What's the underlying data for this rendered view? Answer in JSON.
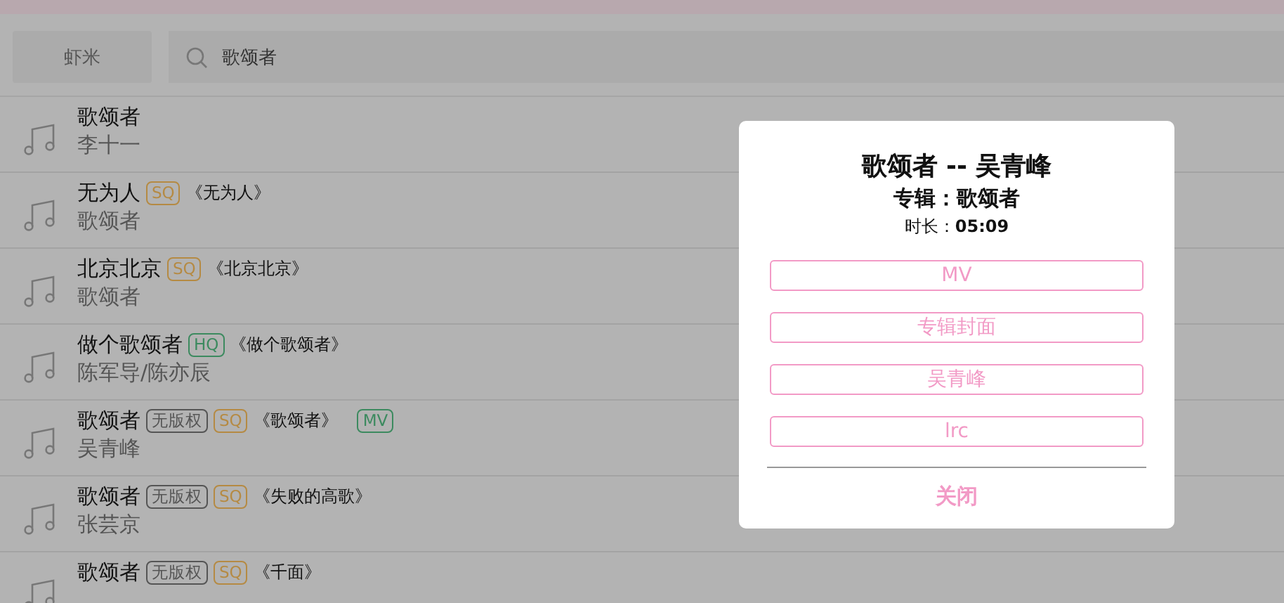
{
  "source_button": {
    "label": "虾米"
  },
  "search": {
    "value": "歌颂者"
  },
  "songs": [
    {
      "title": "歌颂者",
      "artist": "李十一"
    },
    {
      "title": "无为人",
      "tags": [
        {
          "kind": "sq",
          "label": "SQ"
        }
      ],
      "album": "《无为人》",
      "artist": "歌颂者"
    },
    {
      "title": "北京北京",
      "tags": [
        {
          "kind": "sq",
          "label": "SQ"
        }
      ],
      "album": "《北京北京》",
      "artist": "歌颂者"
    },
    {
      "title": "做个歌颂者",
      "tags": [
        {
          "kind": "hq",
          "label": "HQ"
        }
      ],
      "album": "《做个歌颂者》",
      "artist": "陈军导/陈亦辰"
    },
    {
      "title": "歌颂者",
      "tags": [
        {
          "kind": "noright",
          "label": "无版权"
        },
        {
          "kind": "sq",
          "label": "SQ"
        }
      ],
      "album": "《歌颂者》",
      "extra_tags": [
        {
          "kind": "mv",
          "label": "MV"
        }
      ],
      "artist": "吴青峰"
    },
    {
      "title": "歌颂者",
      "tags": [
        {
          "kind": "noright",
          "label": "无版权"
        },
        {
          "kind": "sq",
          "label": "SQ"
        }
      ],
      "album": "《失败的高歌》",
      "artist": "张芸京"
    },
    {
      "title": "歌颂者",
      "tags": [
        {
          "kind": "noright",
          "label": "无版权"
        },
        {
          "kind": "sq",
          "label": "SQ"
        }
      ],
      "album": "《千面》"
    }
  ],
  "dialog": {
    "title": "歌颂者 -- 吴青峰",
    "album": "专辑：歌颂者",
    "duration_label": "时长：",
    "duration": "05:09",
    "buttons": [
      "MV",
      "专辑封面",
      "吴青峰",
      "lrc"
    ],
    "close": "关闭"
  }
}
